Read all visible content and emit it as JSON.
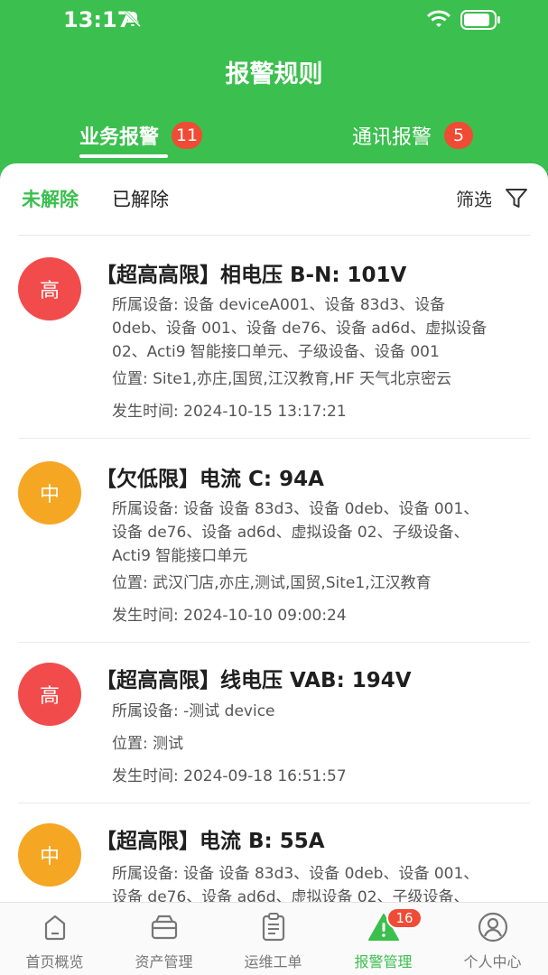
{
  "status_bar": {
    "time": "13:17"
  },
  "header": {
    "title": "报警规则"
  },
  "tabs": [
    {
      "label": "业务报警",
      "count": "11"
    },
    {
      "label": "通讯报警",
      "count": "5"
    }
  ],
  "subtabs": {
    "unresolved": "未解除",
    "resolved": "已解除",
    "filter": "筛选"
  },
  "alarms": [
    {
      "level": "高",
      "title": "【超高高限】相电压 B-N:  101V",
      "device_lines": [
        "所属设备: 设备 deviceA001、设备 83d3、设备",
        "0deb、设备 001、设备 de76、设备 ad6d、虚拟设备",
        "02、Acti9 智能接口单元、子级设备、设备 001"
      ],
      "location": "位置: Site1,亦庄,国贸,江汉教育,HF 天气北京密云",
      "time": "发生时间: 2024-10-15 13:17:21"
    },
    {
      "level": "中",
      "title": "【欠低限】电流 C:  94A",
      "device_lines": [
        "所属设备: 设备 设备 83d3、设备 0deb、设备 001、",
        "设备 de76、设备 ad6d、虚拟设备 02、子级设备、",
        "Acti9 智能接口单元"
      ],
      "location": "位置: 武汉门店,亦庄,测试,国贸,Site1,江汉教育",
      "time": "发生时间: 2024-10-10 09:00:24"
    },
    {
      "level": "高",
      "title": "【超高高限】线电压 VAB:  194V",
      "device_lines": [
        "所属设备: -测试 device"
      ],
      "location": "位置: 测试",
      "time": "发生时间: 2024-09-18 16:51:57"
    },
    {
      "level": "中",
      "title": "【超高限】电流 B:  55A",
      "device_lines": [
        "所属设备: 设备 设备 83d3、设备 0deb、设备 001、",
        "设备 de76、设备 ad6d、虚拟设备 02、子级设备、"
      ],
      "location": "",
      "time": ""
    }
  ],
  "bottom_nav": [
    {
      "label": "首页概览",
      "icon": "home-icon"
    },
    {
      "label": "资产管理",
      "icon": "asset-icon"
    },
    {
      "label": "运维工单",
      "icon": "clipboard-icon"
    },
    {
      "label": "报警管理",
      "icon": "alarm-icon",
      "badge": "16"
    },
    {
      "label": "个人中心",
      "icon": "user-icon"
    }
  ],
  "colors": {
    "brand_green": "#3bbf4e",
    "high": "#f24b4b",
    "mid": "#f5a623",
    "badge_red": "#f04b35"
  }
}
